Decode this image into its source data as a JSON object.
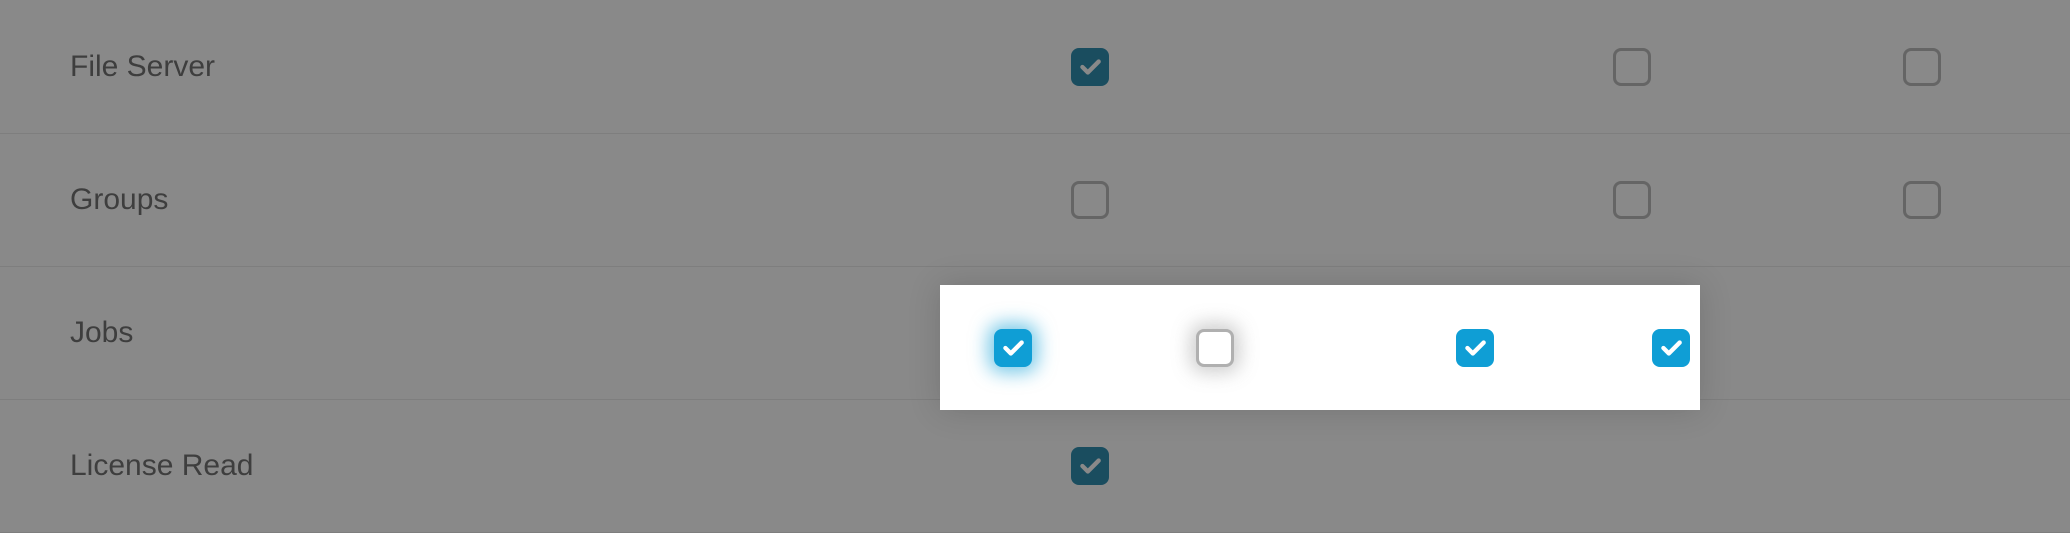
{
  "rows": [
    {
      "label": "File Server",
      "cells": [
        {
          "c": true,
          "dark": true
        },
        null,
        {
          "c": false
        },
        {
          "c": false
        }
      ]
    },
    {
      "label": "Groups",
      "cells": [
        {
          "c": false
        },
        null,
        {
          "c": false
        },
        {
          "c": false
        }
      ]
    },
    {
      "label": "Jobs",
      "cells": [
        {
          "c": true
        },
        {
          "c": false
        },
        {
          "c": true
        },
        {
          "c": true
        }
      ]
    },
    {
      "label": "License Read",
      "cells": [
        {
          "c": true,
          "dark": true
        },
        null,
        null,
        null
      ]
    }
  ],
  "highlight": {
    "row_index": 2,
    "cells": [
      {
        "c": true
      },
      {
        "c": false
      },
      {
        "c": true
      },
      {
        "c": true
      }
    ]
  },
  "colors": {
    "checked": "#0f9ed5",
    "checked_dark": "#0a7aa3",
    "border": "#b0b0b0"
  }
}
